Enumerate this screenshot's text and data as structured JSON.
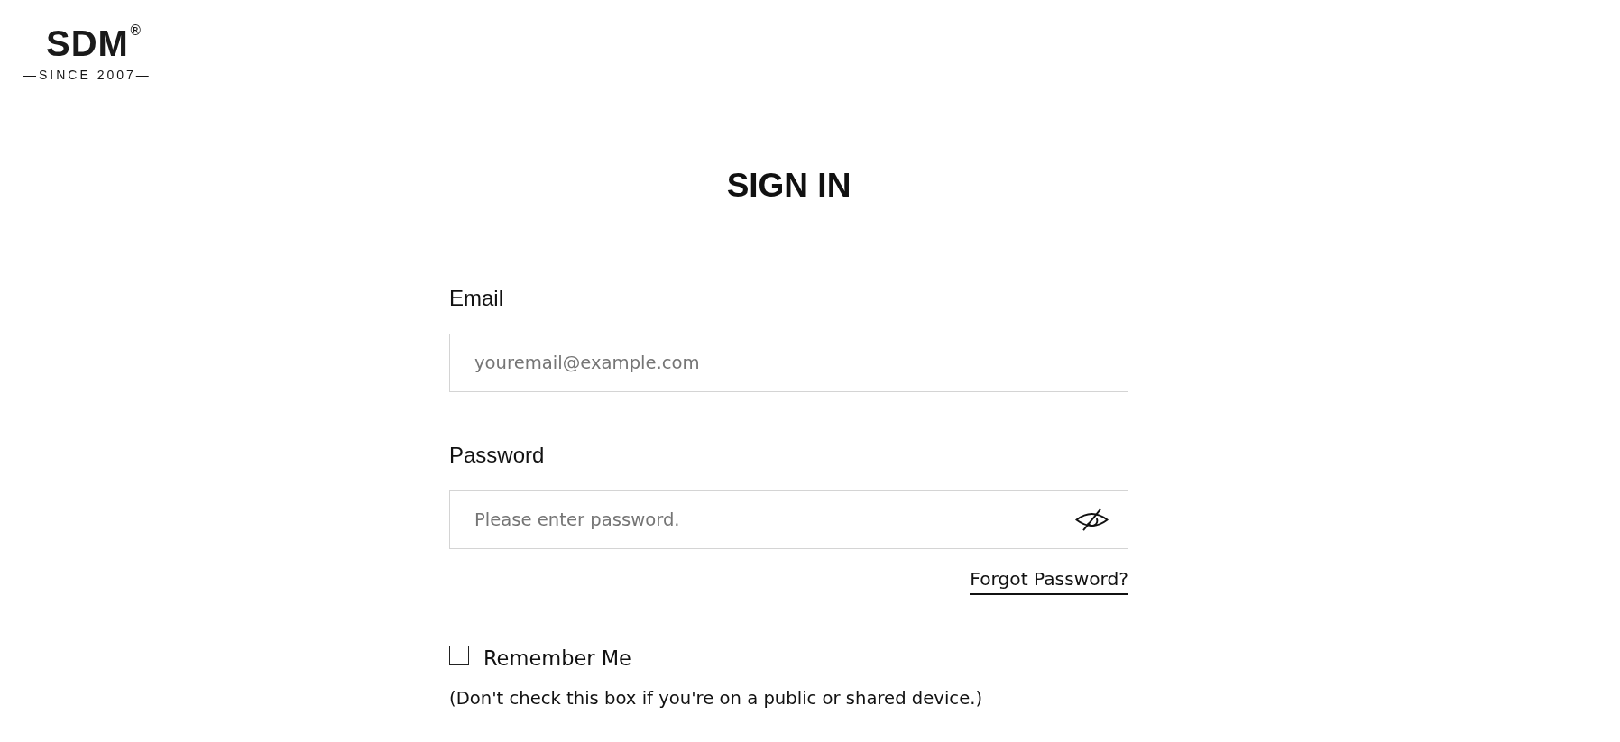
{
  "logo": {
    "wordmark": "SDM",
    "registered": "®",
    "tagline": "—SINCE 2007—"
  },
  "title": "SIGN IN",
  "fields": [
    {
      "kind": "email",
      "label": "Email",
      "placeholder": "youremail@example.com"
    },
    {
      "kind": "password",
      "label": "Password",
      "placeholder": "Please enter password."
    }
  ],
  "forgot_link": "Forgot Password?",
  "remember": {
    "label": "Remember Me",
    "checked": false
  },
  "note": "(Don't check this box if you're on a public or shared device.)"
}
